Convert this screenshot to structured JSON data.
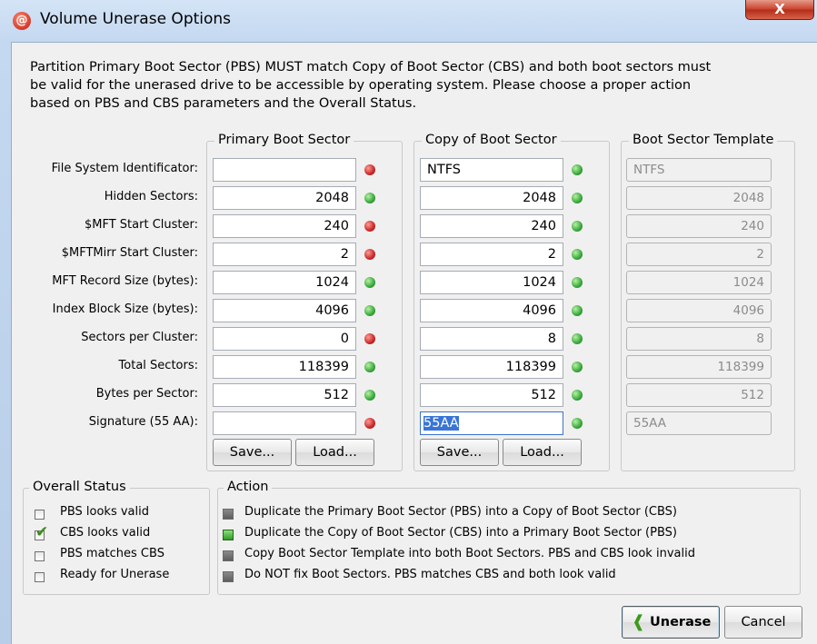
{
  "window": {
    "title": "Volume Unerase Options",
    "app_icon": "@",
    "close_glyph": "X"
  },
  "description": {
    "line1": "Partition Primary Boot Sector (PBS) MUST match Copy of Boot Sector (CBS) and both boot sectors must",
    "line2": "be valid for the unerased drive to be accessible by operating system. Please choose a proper action",
    "line3": "based on PBS and CBS parameters and the Overall Status."
  },
  "row_labels": [
    "File System Identificator:",
    "Hidden Sectors:",
    "$MFT Start Cluster:",
    "$MFTMirr Start Cluster:",
    "MFT Record Size (bytes):",
    "Index Block Size (bytes):",
    "Sectors per Cluster:",
    "Total Sectors:",
    "Bytes per Sector:",
    "Signature (55 AA):"
  ],
  "pbs": {
    "title": "Primary Boot Sector",
    "values": [
      "",
      "2048",
      "240",
      "2",
      "1024",
      "4096",
      "0",
      "118399",
      "512",
      ""
    ],
    "status": [
      "red",
      "green",
      "red",
      "red",
      "green",
      "green",
      "red",
      "green",
      "green",
      "red"
    ],
    "save_label": "Save...",
    "load_label": "Load..."
  },
  "cbs": {
    "title": "Copy of Boot Sector",
    "values": [
      "NTFS",
      "2048",
      "240",
      "2",
      "1024",
      "4096",
      "8",
      "118399",
      "512",
      "55AA"
    ],
    "status": [
      "green",
      "green",
      "green",
      "green",
      "green",
      "green",
      "green",
      "green",
      "green",
      "green"
    ],
    "save_label": "Save...",
    "load_label": "Load..."
  },
  "template": {
    "title": "Boot Sector Template",
    "values": [
      "NTFS",
      "2048",
      "240",
      "2",
      "1024",
      "4096",
      "8",
      "118399",
      "512",
      "55AA"
    ]
  },
  "overall_status": {
    "title": "Overall Status",
    "items": [
      {
        "label": "PBS looks valid",
        "checked": false
      },
      {
        "label": "CBS looks valid",
        "checked": true
      },
      {
        "label": "PBS matches CBS",
        "checked": false
      },
      {
        "label": "Ready for Unerase",
        "checked": false
      }
    ]
  },
  "action": {
    "title": "Action",
    "options": [
      {
        "label": "Duplicate the Primary Boot Sector (PBS) into a Copy of Boot Sector (CBS)",
        "selected": false
      },
      {
        "label": "Duplicate the Copy of Boot Sector (CBS) into a Primary Boot Sector (PBS)",
        "selected": true
      },
      {
        "label": "Copy Boot Sector Template into both Boot Sectors. PBS and CBS look invalid",
        "selected": false
      },
      {
        "label": "Do NOT fix Boot Sectors. PBS matches CBS and both look valid",
        "selected": false
      }
    ]
  },
  "footer": {
    "unerase_label": "Unerase",
    "cancel_label": "Cancel"
  },
  "colors": {
    "led_red": "#c8282a",
    "led_green": "#38a83b",
    "selection": "#3875d7"
  }
}
